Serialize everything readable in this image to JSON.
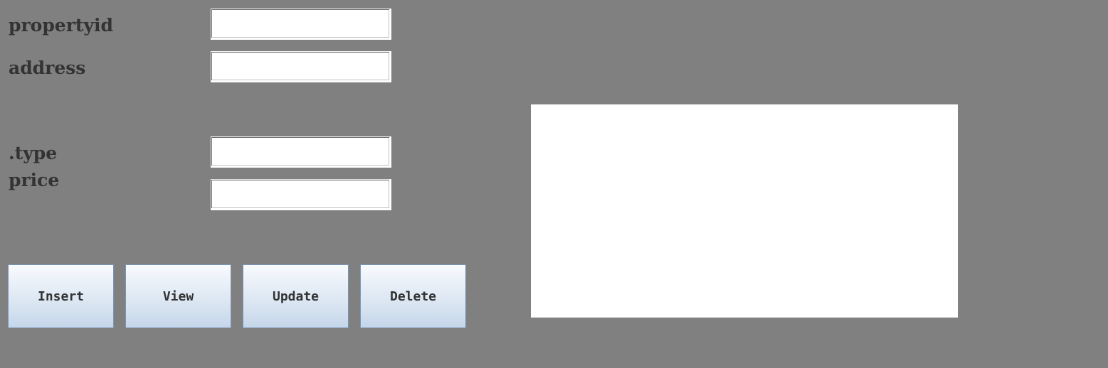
{
  "form": {
    "fields": [
      {
        "label": "propertyid",
        "value": ""
      },
      {
        "label": "address",
        "value": ""
      },
      {
        "label": ".type",
        "value": ""
      },
      {
        "label": "price",
        "value": ""
      }
    ]
  },
  "buttons": {
    "insert": "Insert",
    "view": "View",
    "update": "Update",
    "delete": "Delete"
  },
  "output": {
    "text": ""
  }
}
